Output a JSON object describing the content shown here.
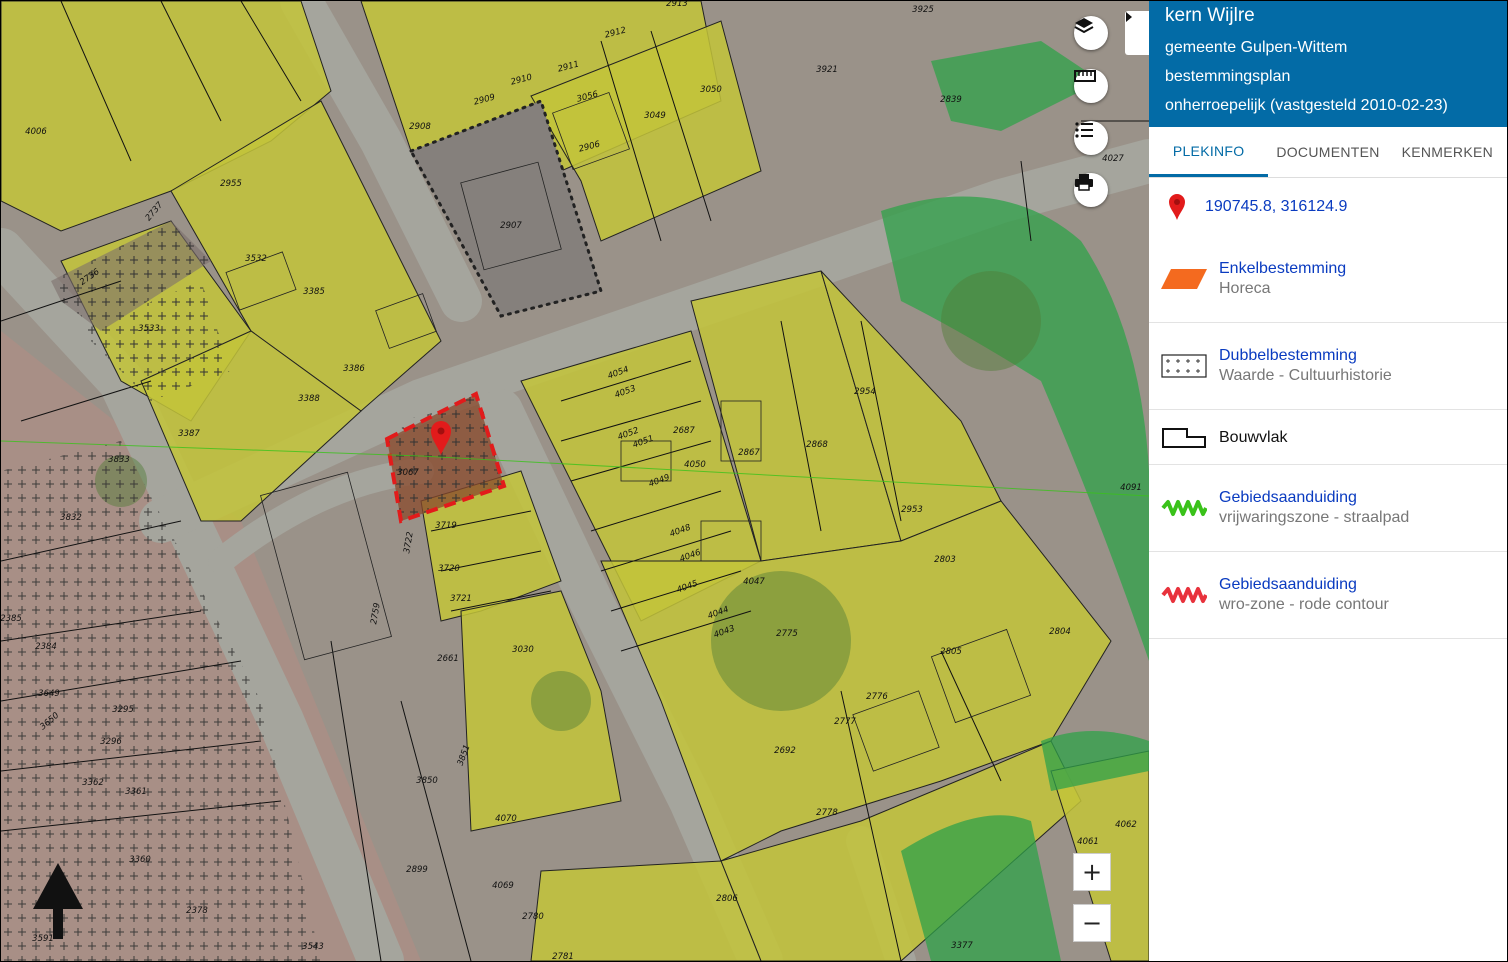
{
  "map": {
    "parcel_numbers": [
      "4006",
      "2955",
      "2737",
      "3532",
      "2736",
      "3533",
      "3385",
      "3386",
      "3388",
      "3387",
      "3833",
      "3832",
      "2909",
      "2908",
      "2910",
      "2911",
      "2912",
      "2913",
      "3056",
      "3050",
      "3049",
      "2906",
      "2907",
      "3925",
      "3921",
      "2839",
      "4027",
      "4054",
      "4053",
      "4052",
      "4051",
      "2687",
      "2867",
      "2868",
      "2954",
      "4050",
      "4049",
      "4048",
      "4046",
      "4045",
      "4044",
      "4043",
      "4047",
      "2775",
      "2953",
      "2803",
      "2804",
      "2805",
      "2776",
      "2777",
      "2692",
      "2778",
      "2806",
      "4091",
      "4062",
      "4061",
      "3377",
      "3067",
      "3719",
      "3720",
      "3721",
      "3722",
      "2759",
      "2661",
      "3030",
      "3851",
      "3850",
      "2899",
      "4069",
      "2780",
      "2781",
      "4070",
      "3543",
      "2378",
      "3591",
      "3360",
      "3362",
      "3361",
      "3295",
      "3296",
      "3650",
      "3649",
      "2384",
      "2385"
    ],
    "marker_icon": "map-pin-icon",
    "north_arrow_icon": "north-arrow-icon"
  },
  "controls": {
    "layers_icon": "layers-icon",
    "measure_icon": "ruler-icon",
    "legend_icon": "list-icon",
    "print_icon": "printer-icon",
    "zoom_in_label": "+",
    "zoom_out_label": "−",
    "collapse_icon": "caret-right-icon"
  },
  "panel": {
    "header": {
      "title": "kern Wijlre",
      "municipality": "gemeente Gulpen-Wittem",
      "plan_type": "bestemmingsplan",
      "status": "onherroepelijk (vastgesteld 2010-02-23)"
    },
    "tabs": [
      "PLEKINFO",
      "DOCUMENTEN",
      "KENMERKEN"
    ],
    "active_tab": "PLEKINFO",
    "coordinates": "190745.8, 316124.9",
    "items": [
      {
        "title": "Enkelbestemming",
        "subtitle": "Horeca",
        "symbol": "orange-parallelogram",
        "color": "#f46a1f"
      },
      {
        "title": "Dubbelbestemming",
        "subtitle": "Waarde - Cultuurhistorie",
        "symbol": "cross-hatch-box"
      },
      {
        "title": "Bouwvlak",
        "subtitle": "",
        "symbol": "outline-shape"
      },
      {
        "title": "Gebiedsaanduiding",
        "subtitle": "vrijwaringszone - straalpad",
        "symbol": "green-zigzag",
        "color": "#3ac21a"
      },
      {
        "title": "Gebiedsaanduiding",
        "subtitle": "wro-zone - rode contour",
        "symbol": "red-zigzag",
        "color": "#e8323c"
      }
    ]
  },
  "colors": {
    "header_bg": "#036ba6",
    "link": "#0a3bc0",
    "zone_yellow": "#c5c43a",
    "road_grey": "#a3a39b",
    "green_zone": "#2fa24a",
    "selection_red": "#e21b1b"
  }
}
